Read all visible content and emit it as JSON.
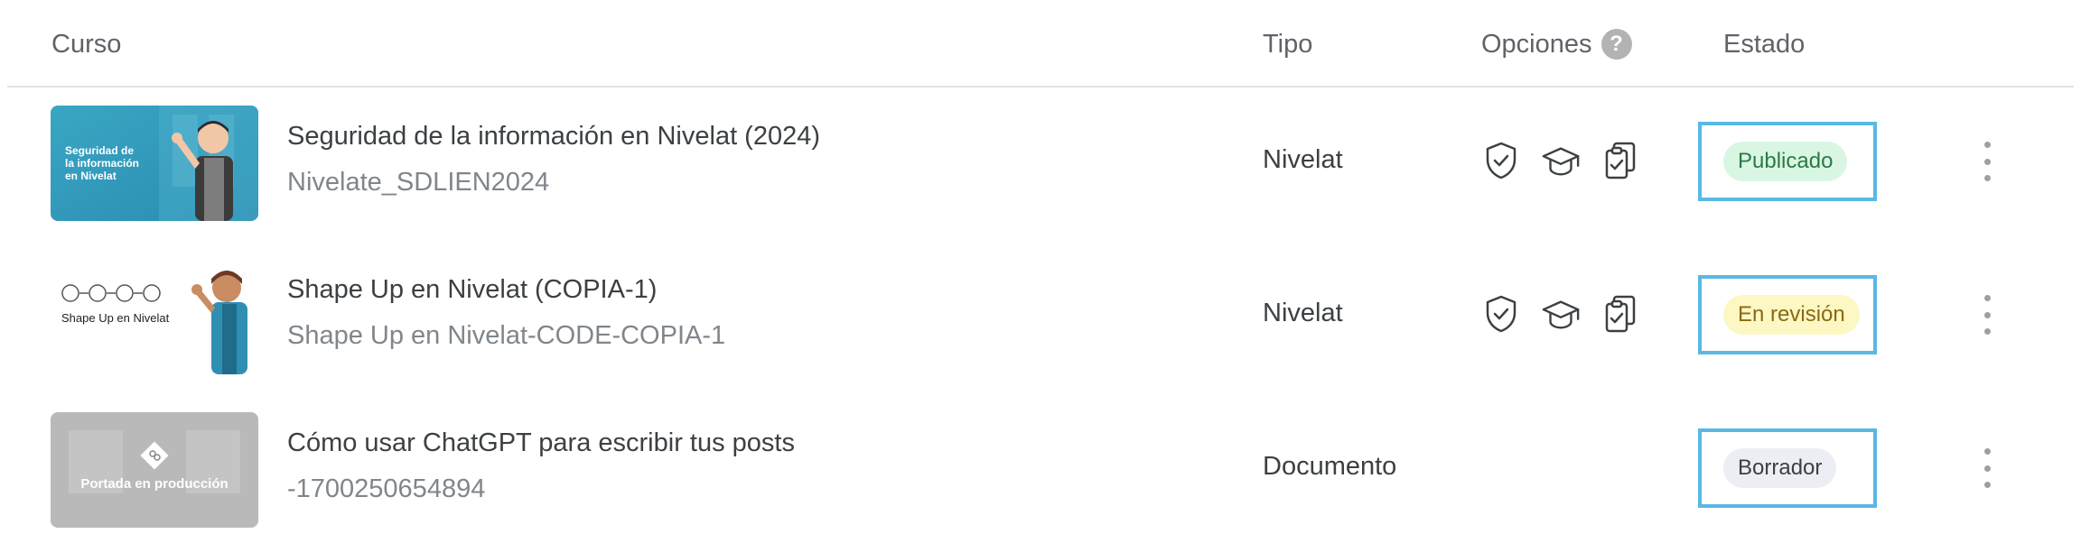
{
  "table": {
    "headers": {
      "course": "Curso",
      "type": "Tipo",
      "options": "Opciones",
      "status": "Estado",
      "help_icon": "?"
    },
    "rows": [
      {
        "title": "Seguridad de la información en Nivelat (2024)",
        "code": "Nivelate_SDLIEN2024",
        "type": "Nivelat",
        "status": "Publicado",
        "thumbnail_text": [
          "Seguridad de",
          "la información",
          "en Nivelat"
        ],
        "options_icons": [
          "shield-check-icon",
          "graduation-cap-icon",
          "clipboard-check-icon"
        ]
      },
      {
        "title": "Shape Up en Nivelat (COPIA-1)",
        "code": "Shape Up en Nivelat-CODE-COPIA-1",
        "type": "Nivelat",
        "status": "En revisión",
        "thumbnail_text": [
          "Shape Up en Nivelat"
        ],
        "options_icons": [
          "shield-check-icon",
          "graduation-cap-icon",
          "clipboard-check-icon"
        ]
      },
      {
        "title": "Cómo usar ChatGPT para escribir tus posts",
        "code": "-1700250654894",
        "type": "Documento",
        "status": "Borrador",
        "thumbnail_text": [
          "Portada en producción"
        ],
        "options_icons": []
      }
    ]
  },
  "colors": {
    "status_published_bg": "#d9f6e3",
    "status_review_bg": "#fdf7c4",
    "status_draft_bg": "#eceef4",
    "highlight_border": "#5ab8e4"
  }
}
